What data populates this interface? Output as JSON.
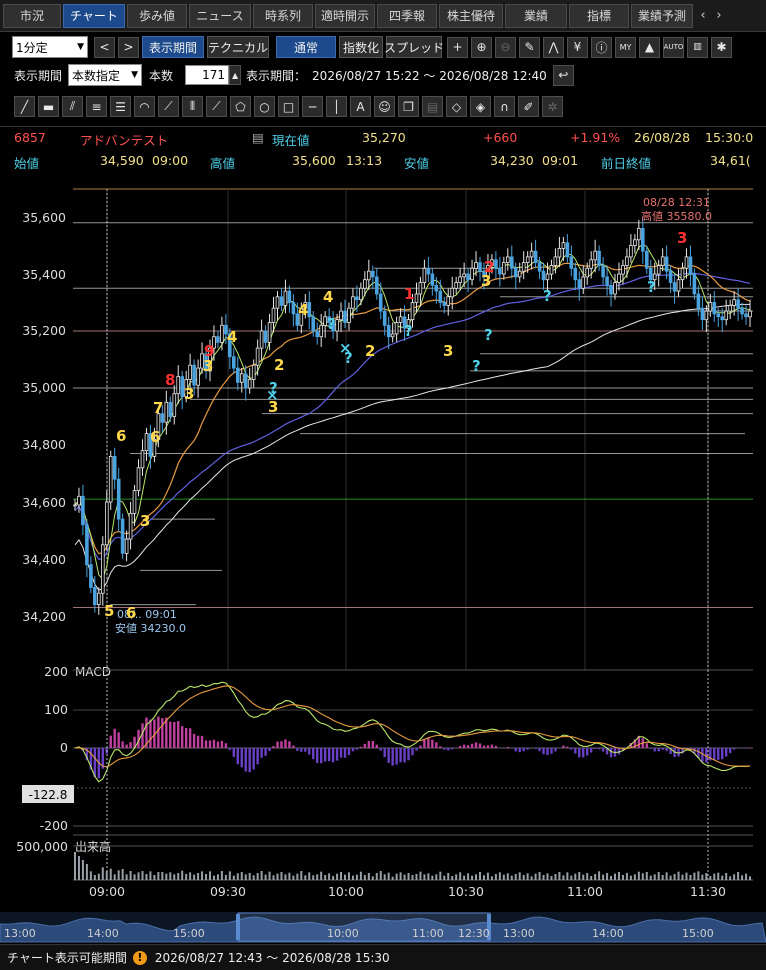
{
  "tabs": [
    {
      "label": "市況",
      "active": false
    },
    {
      "label": "チャート",
      "active": true
    },
    {
      "label": "歩み値",
      "active": false
    },
    {
      "label": "ニュース",
      "active": false
    },
    {
      "label": "時系列",
      "active": false
    },
    {
      "label": "適時開示",
      "active": false
    },
    {
      "label": "四季報",
      "active": false
    },
    {
      "label": "株主優待",
      "active": false
    },
    {
      "label": "業績",
      "active": false
    },
    {
      "label": "指標",
      "active": false
    },
    {
      "label": "業績予測",
      "active": false
    }
  ],
  "tab_nav": {
    "prev": "‹",
    "next": "›"
  },
  "toolbar1": {
    "interval": "1分定",
    "period_label": "表示期間",
    "technical_label": "テクニカル",
    "normal_label": "通常",
    "indexed_label": "指数化",
    "spread_label": "スプレッド"
  },
  "toolbar2": {
    "period_label": "表示期間",
    "period_mode": "本数指定",
    "count_label": "本数",
    "count_value": "171",
    "range_label": "表示期間：",
    "range_value": "2026/08/27 15:22 〜 2026/08/28 12:40"
  },
  "quote": {
    "code": "6857",
    "name": "アドバンテスト",
    "current_label": "現在値",
    "current_value": "35,270",
    "change": "+660",
    "change_pct": "+1.91%",
    "date": "26/08/28",
    "time": "15:30:0",
    "open_label": "始値",
    "open_value": "34,590",
    "open_time": "09:00",
    "high_label": "高値",
    "high_value": "35,600",
    "high_time": "13:13",
    "low_label": "安値",
    "low_value": "34,230",
    "low_time": "09:01",
    "prev_label": "前日終値",
    "prev_value": "34,61("
  },
  "main_chart": {
    "y_ticks": [
      "35,600",
      "35,400",
      "35,200",
      "35,000",
      "34,800",
      "34,600",
      "34,400",
      "34,200"
    ],
    "high_annotation": {
      "date": "08/28 12:31",
      "text": "高値 35580.0"
    },
    "low_annotation": {
      "date": "08/.. 09:01",
      "text": "安値 34230.0"
    },
    "markers": {
      "yellow": [
        "6",
        "6",
        "7",
        "3",
        "3",
        "4",
        "4",
        "2",
        "3",
        "4",
        "2",
        "3",
        "3",
        "5",
        "6",
        "3"
      ],
      "red": [
        "8",
        "9",
        "1",
        "2",
        "3"
      ],
      "cross": [
        "×",
        "×"
      ],
      "question": [
        "?",
        "?",
        "?",
        "?",
        "?",
        "?",
        "?",
        "?"
      ]
    }
  },
  "macd": {
    "label": "MACD",
    "y_ticks": [
      "200",
      "100",
      "0",
      "-200"
    ],
    "current_value": "-122.8"
  },
  "volume": {
    "label": "出来高",
    "y_tick": "500,000"
  },
  "x_ticks": [
    "09:00",
    "09:30",
    "10:00",
    "10:30",
    "11:00",
    "11:30"
  ],
  "navigator": {
    "labels": [
      "13:00",
      "14:00",
      "15:00",
      "10:00",
      "11:00",
      "12:30",
      "13:00",
      "14:00",
      "15:00"
    ]
  },
  "footer": {
    "label": "チャート表示可能期間",
    "range": "2026/08/27 12:43 〜 2026/08/28 15:30"
  },
  "chart_data": {
    "type": "candlestick",
    "x_ticks": [
      "09:00",
      "09:30",
      "10:00",
      "10:30",
      "11:00",
      "11:30"
    ],
    "close": [
      34590,
      34620,
      34520,
      34380,
      34300,
      34240,
      34280,
      34450,
      34600,
      34760,
      34680,
      34540,
      34420,
      34470,
      34560,
      34640,
      34720,
      34780,
      34840,
      34760,
      34820,
      34910,
      34880,
      34950,
      34900,
      34980,
      35040,
      34970,
      35030,
      35080,
      35010,
      35070,
      35120,
      35060,
      35140,
      35180,
      35160,
      35220,
      35190,
      35110,
      35070,
      35020,
      35050,
      35000,
      35030,
      35080,
      35140,
      35200,
      35160,
      35230,
      35280,
      35320,
      35290,
      35340,
      35300,
      35260,
      35220,
      35280,
      35300,
      35250,
      35200,
      35180,
      35220,
      35250,
      35230,
      35200,
      35240,
      35270,
      35230,
      35280,
      35320,
      35310,
      35350,
      35380,
      35410,
      35390,
      35330,
      35270,
      35220,
      35180,
      35190,
      35230,
      35250,
      35210,
      35240,
      35300,
      35330,
      35370,
      35420,
      35400,
      35360,
      35340,
      35300,
      35290,
      35320,
      35350,
      35370,
      35390,
      35400,
      35380,
      35420,
      35440,
      35410,
      35390,
      35430,
      35450,
      35420,
      35400,
      35440,
      35460,
      35420,
      35390,
      35410,
      35440,
      35460,
      35480,
      35440,
      35410,
      35380,
      35400,
      35430,
      35460,
      35490,
      35510,
      35460,
      35420,
      35380,
      35350,
      35390,
      35420,
      35450,
      35480,
      35430,
      35390,
      35360,
      35330,
      35370,
      35400,
      35430,
      35460,
      35500,
      35520,
      35560,
      35480,
      35420,
      35380,
      35400,
      35430,
      35460,
      35410,
      35370,
      35340,
      35380,
      35420,
      35460,
      35400,
      35330,
      35280,
      35240,
      35270,
      35300,
      35260,
      35250,
      35240,
      35270,
      35290,
      35310,
      35280,
      35260,
      35250,
      35270
    ],
    "open_value": 34590,
    "high_value": 35600,
    "low_value": 34230,
    "current_value": 35270,
    "ylim": [
      34200,
      35700
    ]
  }
}
